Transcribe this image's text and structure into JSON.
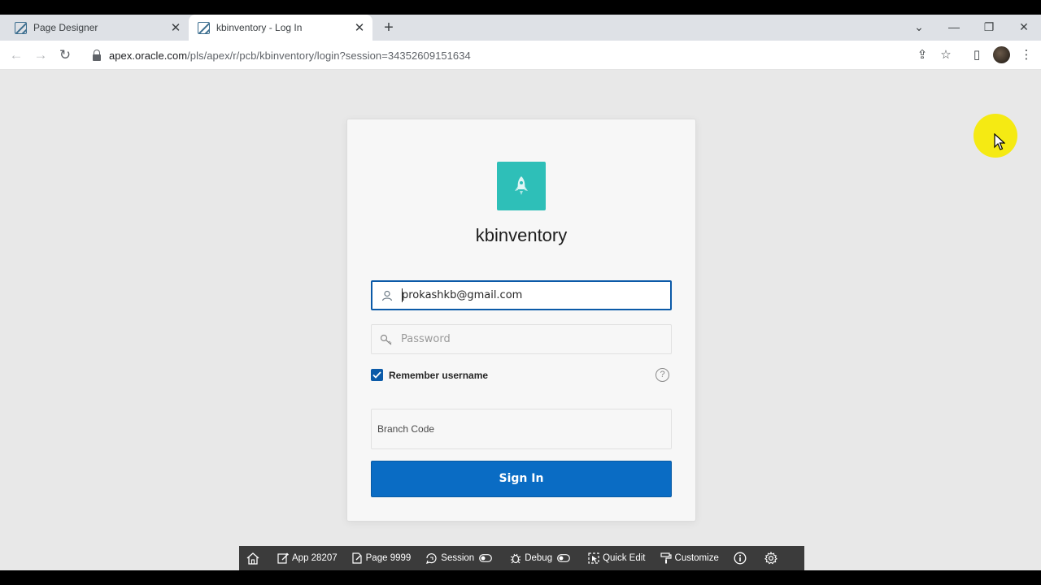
{
  "browser": {
    "tabs": [
      {
        "title": "Page Designer",
        "active": false
      },
      {
        "title": "kbinventory - Log In",
        "active": true
      }
    ],
    "url_host": "apex.oracle.com",
    "url_path": "/pls/apex/r/pcb/kbinventory/login?session=34352609151634"
  },
  "login": {
    "app_title": "kbinventory",
    "username_value": "prokashkb@gmail.com",
    "password_placeholder": "Password",
    "remember_label": "Remember username",
    "remember_checked": true,
    "help_glyph": "?",
    "branch_label": "Branch Code",
    "signin_label": "Sign In"
  },
  "dev_toolbar": {
    "app": "App 28207",
    "page": "Page 9999",
    "session": "Session",
    "debug": "Debug",
    "quick_edit": "Quick Edit",
    "customize": "Customize"
  },
  "colors": {
    "logo_bg": "#2ebfb8",
    "primary_button": "#0a6cc4",
    "focus_border": "#0b5aa8",
    "cursor_highlight": "#f5e900"
  }
}
